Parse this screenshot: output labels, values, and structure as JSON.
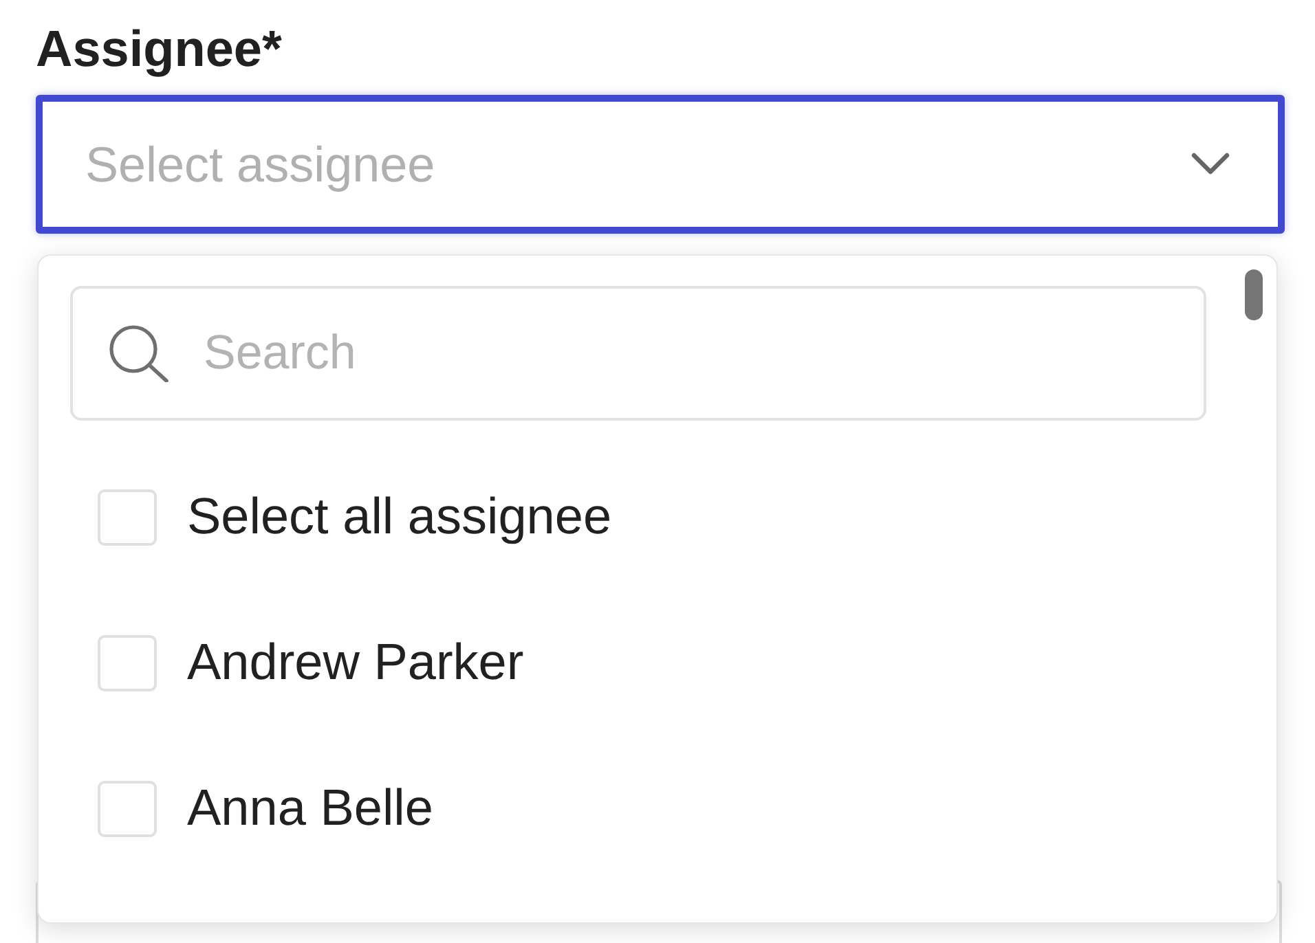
{
  "field": {
    "label": "Assignee*",
    "placeholder": "Select assignee",
    "focused": true,
    "expanded": true
  },
  "dropdown": {
    "search": {
      "placeholder": "Search"
    },
    "options": [
      {
        "label": "Select all assignee",
        "checked": false
      },
      {
        "label": "Andrew Parker",
        "checked": false
      },
      {
        "label": "Anna Belle",
        "checked": false
      }
    ]
  }
}
